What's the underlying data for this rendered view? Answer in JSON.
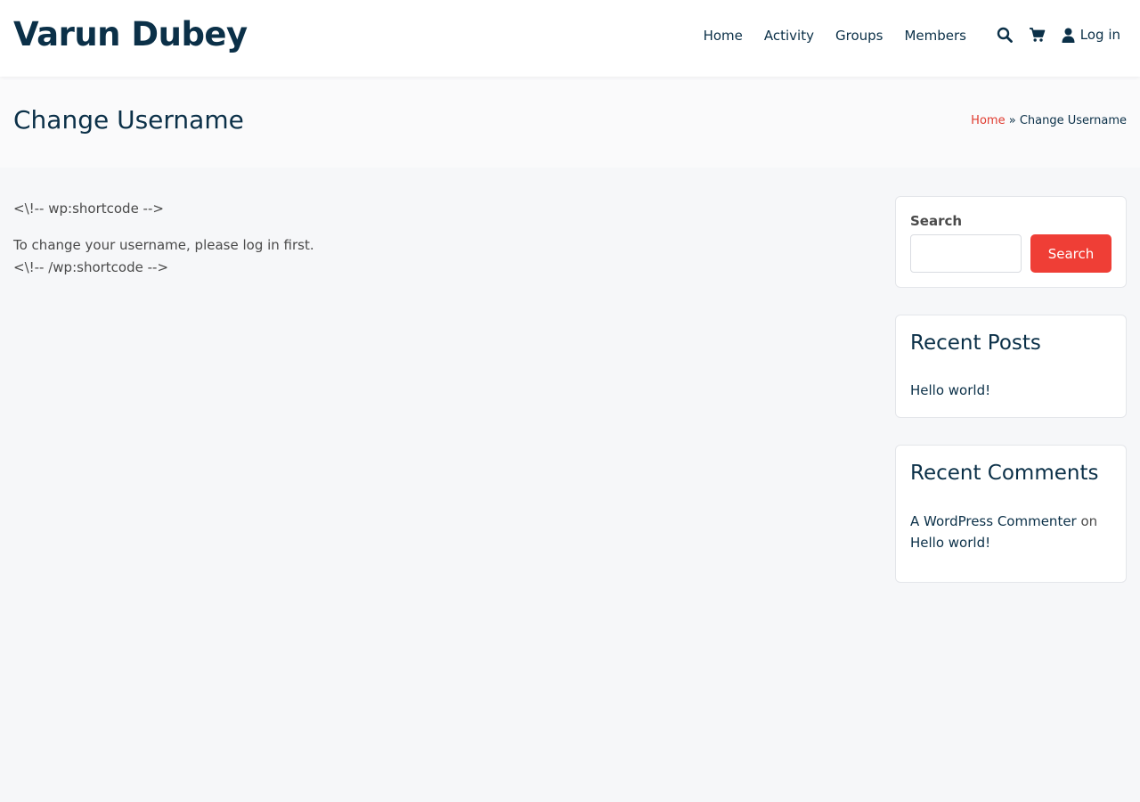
{
  "site": {
    "title": "Varun Dubey"
  },
  "nav": {
    "items": [
      {
        "label": "Home"
      },
      {
        "label": "Activity"
      },
      {
        "label": "Groups"
      },
      {
        "label": "Members"
      }
    ]
  },
  "header_icons": {
    "search": "search-icon",
    "cart": "cart-icon",
    "user": "user-icon",
    "login_label": "Log in"
  },
  "page": {
    "title": "Change Username",
    "breadcrumb": {
      "home": "Home",
      "separator": "»",
      "current": "Change Username"
    }
  },
  "content": {
    "lines": [
      "<\\!-- wp:shortcode -->",
      "To change your username, please log in first.",
      "<\\!-- /wp:shortcode -->"
    ]
  },
  "sidebar": {
    "search": {
      "label": "Search",
      "placeholder": "",
      "button_label": "Search"
    },
    "recent_posts": {
      "title": "Recent Posts",
      "items": [
        "Hello world!"
      ]
    },
    "recent_comments": {
      "title": "Recent Comments",
      "author": "A WordPress Commenter",
      "connector": "on",
      "post": "Hello world!"
    }
  },
  "colors": {
    "brand_dark": "#0b3048",
    "accent_red": "#ef3e36",
    "breadcrumb_link": "#e03b2f",
    "page_background": "#f6f7f9"
  }
}
